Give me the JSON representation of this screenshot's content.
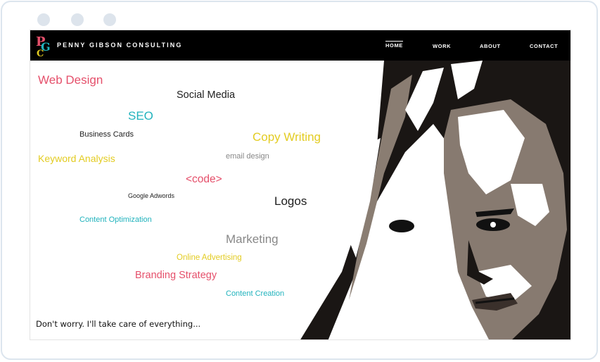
{
  "header": {
    "brand": "PENNY GIBSON CONSULTING",
    "logo_letters": [
      "P",
      "G",
      "C"
    ],
    "nav": [
      {
        "label": "HOME",
        "active": true
      },
      {
        "label": "WORK",
        "active": false
      },
      {
        "label": "ABOUT",
        "active": false
      },
      {
        "label": "CONTACT",
        "active": false
      }
    ]
  },
  "services": [
    {
      "text": "Web Design",
      "color": "#e5506b"
    },
    {
      "text": "Social Media",
      "color": "#1e1e1e"
    },
    {
      "text": "SEO",
      "color": "#22b3bd"
    },
    {
      "text": "Business Cards",
      "color": "#1e1e1e"
    },
    {
      "text": "Copy Writing",
      "color": "#e3cc22"
    },
    {
      "text": "Keyword Analysis",
      "color": "#e3cc22"
    },
    {
      "text": "email design",
      "color": "#888888"
    },
    {
      "text": "<code>",
      "color": "#e5506b"
    },
    {
      "text": "Google Adwords",
      "color": "#1e1e1e"
    },
    {
      "text": "Logos",
      "color": "#1e1e1e"
    },
    {
      "text": "Content Optimization",
      "color": "#22b3bd"
    },
    {
      "text": "Marketing",
      "color": "#888888"
    },
    {
      "text": "Online Advertising",
      "color": "#e3cc22"
    },
    {
      "text": "Branding Strategy",
      "color": "#e5506b"
    },
    {
      "text": "Content Creation",
      "color": "#22b3bd"
    }
  ],
  "tagline": "Don't worry. I'll take care of everything...",
  "colors": {
    "pink": "#e5506b",
    "teal": "#22b3bd",
    "yellow": "#e3cc22",
    "navbar": "#000000"
  },
  "hero_image": "woman-portrait"
}
